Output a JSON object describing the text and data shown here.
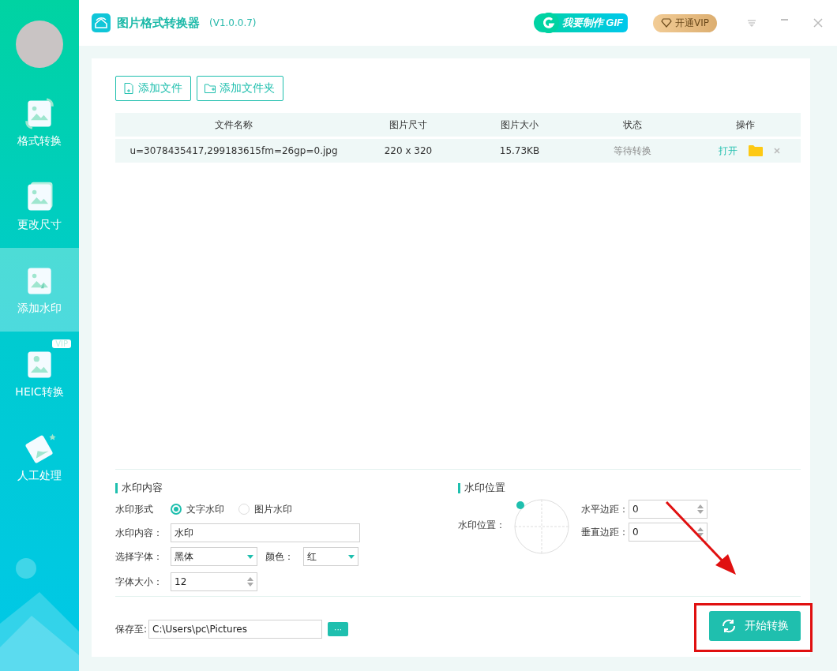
{
  "app": {
    "title": "图片格式转换器",
    "version": "(V1.0.0.7)"
  },
  "header": {
    "gif_button": "我要制作",
    "gif_tag": "GIF",
    "vip_button": "开通VIP"
  },
  "sidebar": {
    "items": [
      {
        "label": "格式转换",
        "kind": "convert",
        "selected": false
      },
      {
        "label": "更改尺寸",
        "kind": "resize",
        "selected": false
      },
      {
        "label": "添加水印",
        "kind": "watermark",
        "selected": true
      },
      {
        "label": "HEIC转换",
        "kind": "heic",
        "selected": false,
        "badge": "VIP"
      },
      {
        "label": "人工处理",
        "kind": "manual",
        "selected": false
      }
    ]
  },
  "toolbar": {
    "buttons": [
      {
        "label": "添加文件",
        "kind": "file"
      },
      {
        "label": "添加文件夹",
        "kind": "folder"
      }
    ]
  },
  "table": {
    "columns": [
      "文件名称",
      "图片尺寸",
      "图片大小",
      "状态",
      "操作"
    ],
    "rows": [
      {
        "name": "u=3078435417,299183615fm=26gp=0.jpg",
        "dimensions": "220 x 320",
        "file_size": "15.73KB",
        "status": "等待转换",
        "action": "打开"
      }
    ]
  },
  "watermark_content": {
    "title": "水印内容",
    "type_label": "水印形式",
    "options": [
      {
        "label": "文字水印",
        "selected": true
      },
      {
        "label": "图片水印",
        "selected": false
      }
    ],
    "content_label": "水印内容：",
    "content_value": "水印",
    "font_label": "选择字体：",
    "font_value": "黑体",
    "color_label": "颜色：",
    "color_value": "红",
    "size_label": "字体大小：",
    "size_value": "12"
  },
  "watermark_position": {
    "title": "水印位置",
    "position_label": "水印位置：",
    "h_label": "水平边距：",
    "h_value": "0",
    "v_label": "垂直边距：",
    "v_value": "0"
  },
  "footer": {
    "save_label": "保存至:",
    "save_path": "C:\\Users\\pc\\Pictures",
    "browse_button": "···",
    "start_button": "开始转换"
  }
}
